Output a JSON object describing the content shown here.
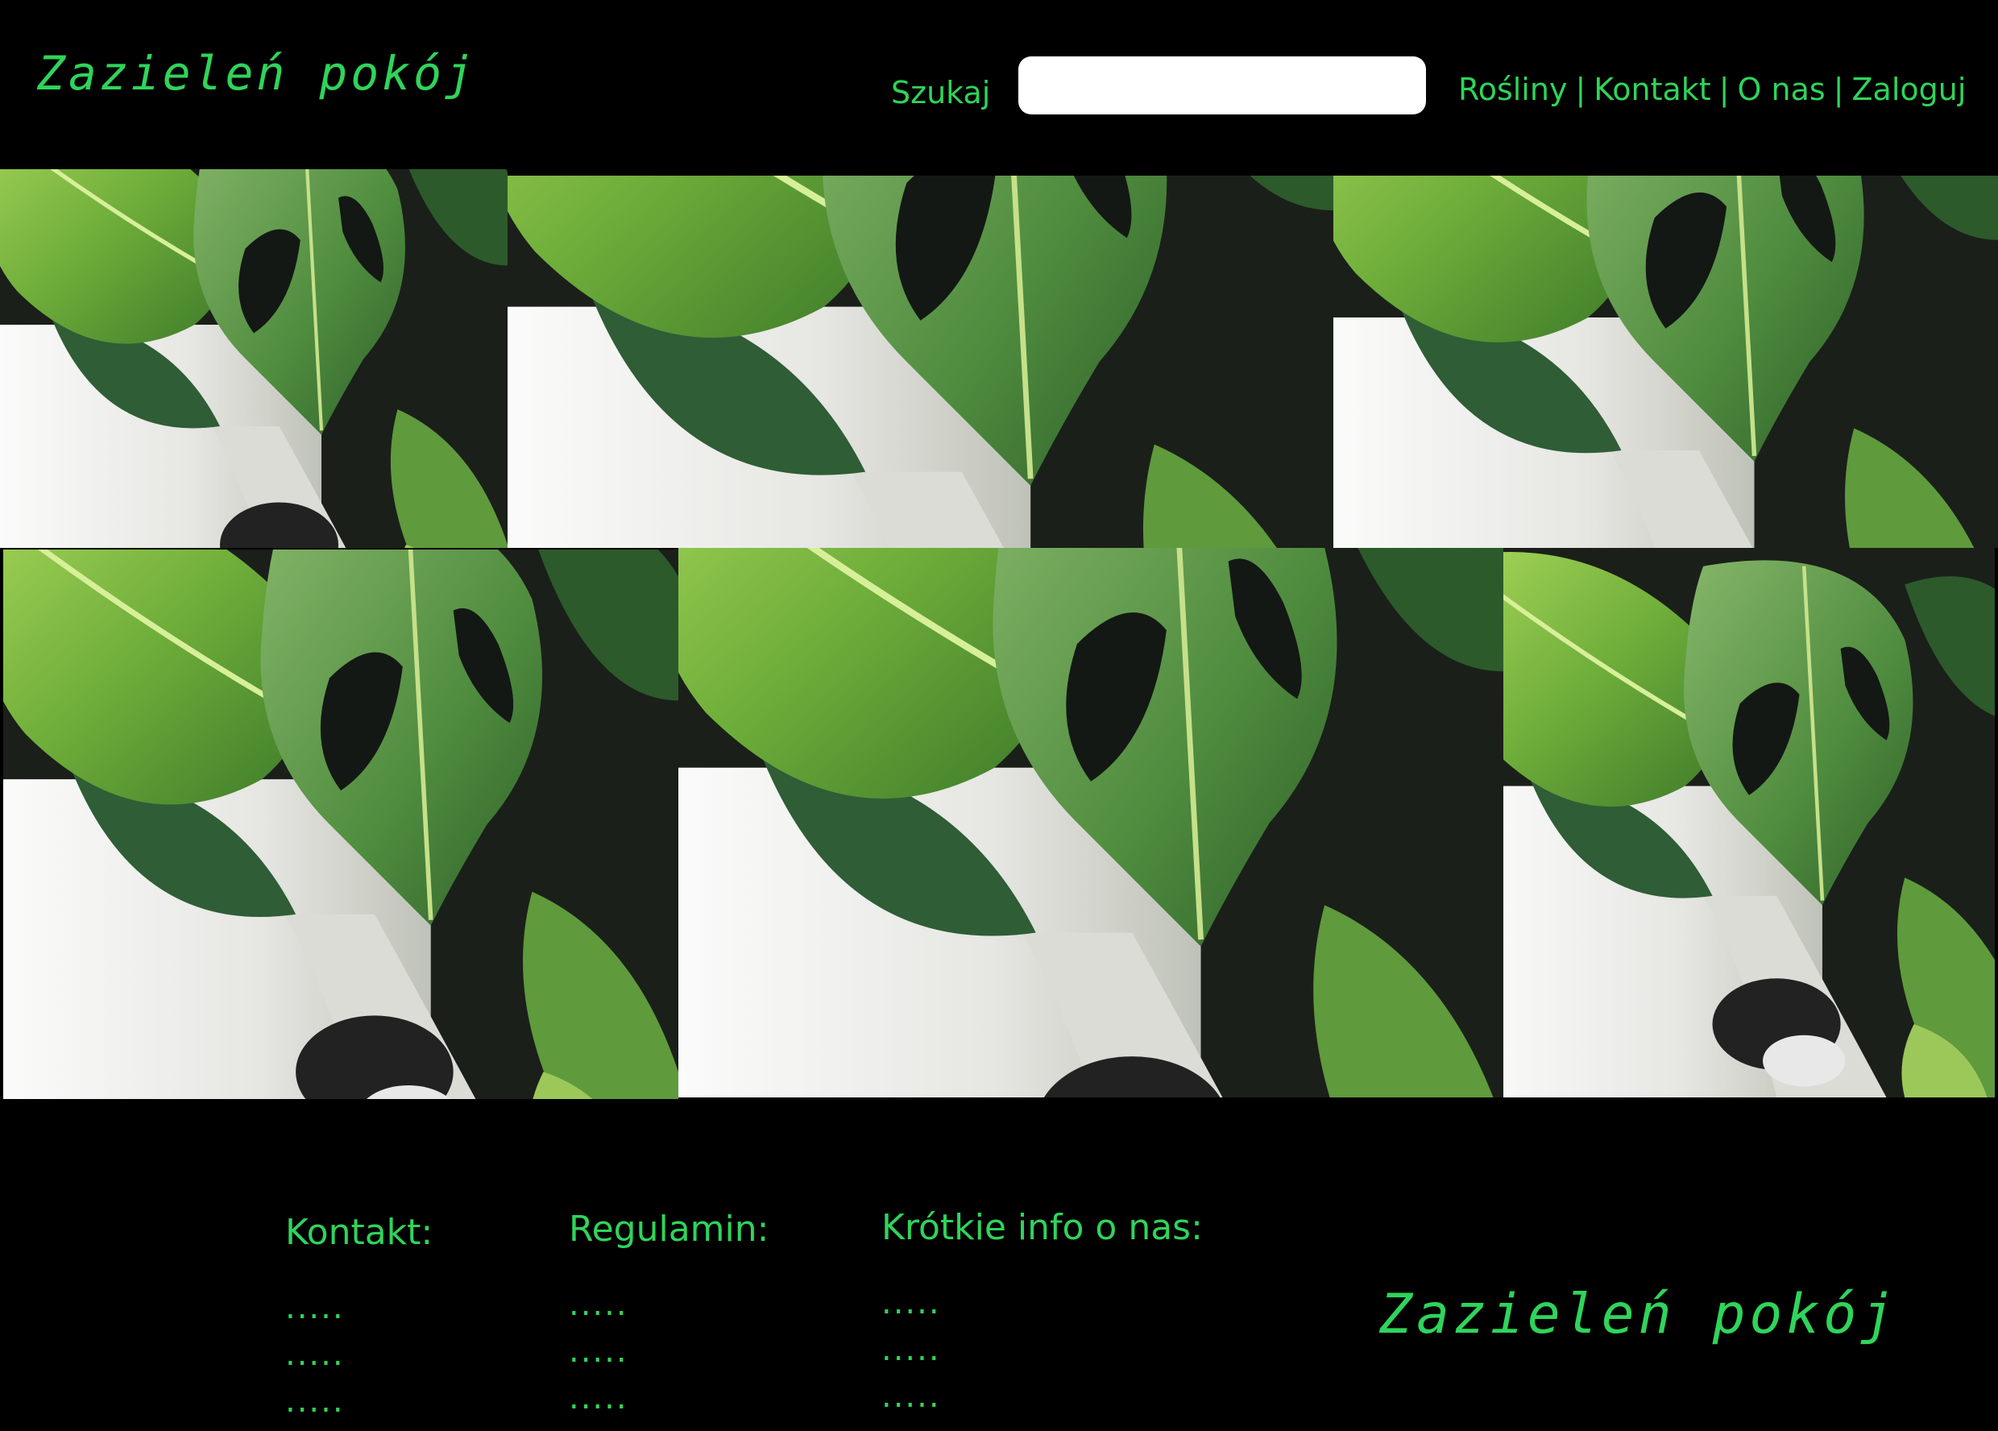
{
  "header": {
    "logo": "Zazieleń pokój",
    "search_label": "Szukaj",
    "search_value": "",
    "nav": [
      "Rośliny",
      "Kontakt",
      "O nas",
      "Zaloguj"
    ],
    "nav_separator": "|"
  },
  "gallery": {
    "image_subject": "monstera-leaves-photo",
    "tile_count": 6
  },
  "footer": {
    "columns": [
      {
        "heading": "Kontakt:",
        "lines": [
          ".....",
          ".....",
          "....."
        ]
      },
      {
        "heading": "Regulamin:",
        "lines": [
          ".....",
          ".....",
          "....."
        ]
      },
      {
        "heading": "Krótkie info o nas:",
        "lines": [
          ".....",
          ".....",
          "....."
        ]
      }
    ],
    "logo": "Zazieleń pokój"
  },
  "colors": {
    "background": "#000000",
    "accent": "#2fd45a",
    "input_bg": "#ffffff"
  }
}
